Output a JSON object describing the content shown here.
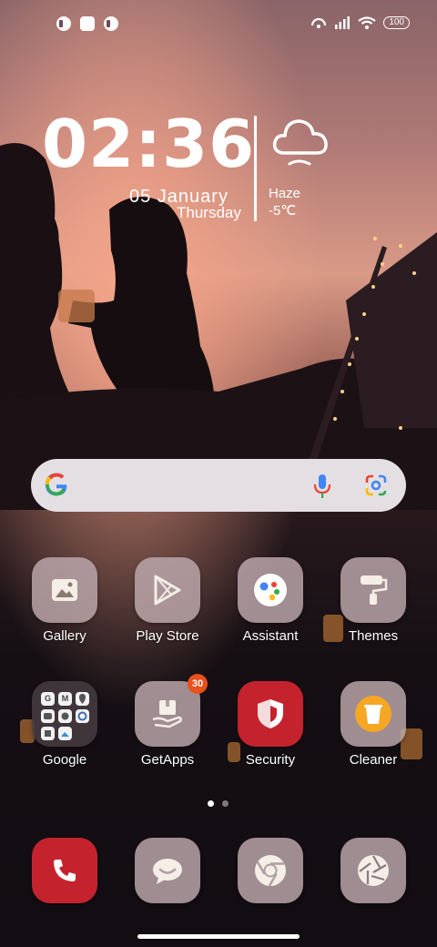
{
  "status_bar": {
    "left_icons": [
      "notification-icon",
      "square-app-icon",
      "notification-icon"
    ],
    "right_icons": [
      "hotspot-icon",
      "signal-icon",
      "wifi-icon"
    ],
    "battery": "100"
  },
  "clock_widget": {
    "time": "02:36",
    "date": "05 January",
    "weekday": "Thursday",
    "weather_icon": "cloud-icon",
    "condition": "Haze",
    "temperature": "-5℃"
  },
  "search_bar": {
    "logo": "G",
    "icons": [
      "mic-icon",
      "lens-icon"
    ],
    "colors": {
      "blue": "#4285f4",
      "red": "#ea4335",
      "yellow": "#fbbc05",
      "green": "#34a853"
    }
  },
  "apps_row1": [
    {
      "label": "Gallery",
      "icon": "gallery-icon"
    },
    {
      "label": "Play Store",
      "icon": "play-store-icon"
    },
    {
      "label": "Assistant",
      "icon": "assistant-icon"
    },
    {
      "label": "Themes",
      "icon": "paint-roller-icon"
    }
  ],
  "apps_row2": [
    {
      "label": "Google",
      "icon": "folder-icon",
      "folder_letters": [
        "G",
        "M",
        "",
        "",
        "",
        "",
        "",
        "",
        ""
      ]
    },
    {
      "label": "GetApps",
      "icon": "getapps-icon",
      "badge": "30"
    },
    {
      "label": "Security",
      "icon": "shield-icon"
    },
    {
      "label": "Cleaner",
      "icon": "trash-icon"
    }
  ],
  "page_indicator": {
    "pages": 2,
    "current": 1
  },
  "dock": [
    {
      "icon": "phone-icon"
    },
    {
      "icon": "message-icon"
    },
    {
      "icon": "chrome-icon"
    },
    {
      "icon": "camera-icon"
    }
  ]
}
